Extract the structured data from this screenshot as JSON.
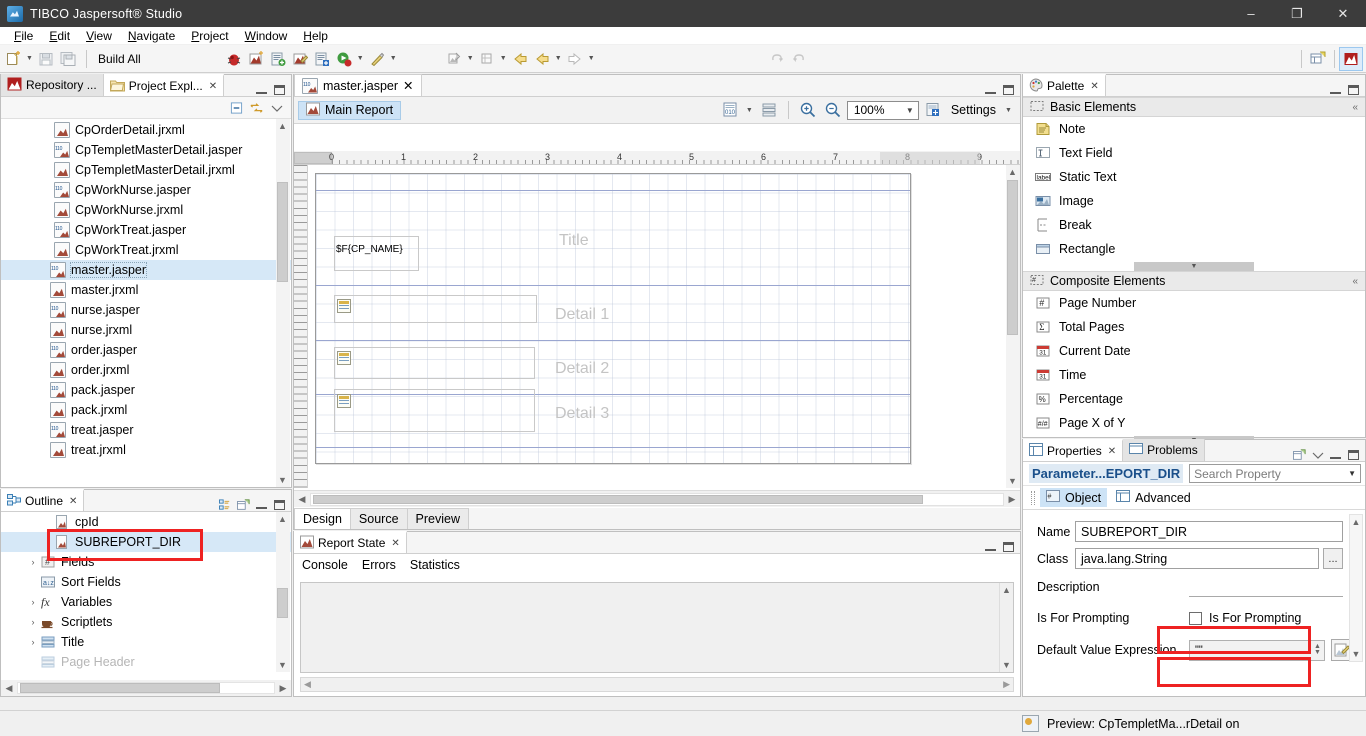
{
  "window": {
    "title": "TIBCO Jaspersoft® Studio",
    "app_icon": "jaspersoft-logo-icon",
    "minimize": "–",
    "maximize": "❐",
    "close": "✕"
  },
  "menubar": {
    "items": [
      "File",
      "Edit",
      "View",
      "Navigate",
      "Project",
      "Window",
      "Help"
    ]
  },
  "toolbar": {
    "build_all_label": "Build All",
    "icons": [
      "new-file-icon",
      "save-icon",
      "save-all-icon",
      "debug-icon",
      "run-report-icon",
      "compile-report-icon",
      "edit-report-icon",
      "preview-report-icon",
      "run-external-icon",
      "run-last-icon",
      "external-tools-icon",
      "next-annotation-icon",
      "previous-annotation-icon",
      "back-icon",
      "forward-icon",
      "undo-arrow-icon",
      "redo-arrow-icon"
    ],
    "perspective_icons": [
      "open-perspective-icon",
      "report-perspective-icon"
    ]
  },
  "project_explorer": {
    "tabs": [
      {
        "label": "Repository ...",
        "icon": "repository-icon",
        "active": false,
        "closeable": false
      },
      {
        "label": "Project Expl...",
        "icon": "project-explorer-icon",
        "active": true,
        "closeable": true
      }
    ],
    "toolbar_icons": [
      "collapse-all-icon",
      "link-with-editor-icon",
      "view-menu-icon"
    ],
    "files": [
      {
        "name": "CpOrderDetail.jrxml",
        "icon": "jrxml-file-icon",
        "selected": false
      },
      {
        "name": "CpTempletMasterDetail.jasper",
        "icon": "jasper-file-icon",
        "selected": false
      },
      {
        "name": "CpTempletMasterDetail.jrxml",
        "icon": "jrxml-file-icon",
        "selected": false
      },
      {
        "name": "CpWorkNurse.jasper",
        "icon": "jasper-file-icon",
        "selected": false
      },
      {
        "name": "CpWorkNurse.jrxml",
        "icon": "jrxml-file-icon",
        "selected": false
      },
      {
        "name": "CpWorkTreat.jasper",
        "icon": "jasper-file-icon",
        "selected": false
      },
      {
        "name": "CpWorkTreat.jrxml",
        "icon": "jrxml-file-icon",
        "selected": false
      },
      {
        "name": "master.jasper",
        "icon": "jasper-file-icon",
        "selected": true
      },
      {
        "name": "master.jrxml",
        "icon": "jrxml-file-icon",
        "selected": false
      },
      {
        "name": "nurse.jasper",
        "icon": "jasper-file-icon",
        "selected": false
      },
      {
        "name": "nurse.jrxml",
        "icon": "jrxml-file-icon",
        "selected": false
      },
      {
        "name": "order.jasper",
        "icon": "jasper-file-icon",
        "selected": false
      },
      {
        "name": "order.jrxml",
        "icon": "jrxml-file-icon",
        "selected": false
      },
      {
        "name": "pack.jasper",
        "icon": "jasper-file-icon",
        "selected": false
      },
      {
        "name": "pack.jrxml",
        "icon": "jrxml-file-icon",
        "selected": false
      },
      {
        "name": "treat.jasper",
        "icon": "jasper-file-icon",
        "selected": false
      },
      {
        "name": "treat.jrxml",
        "icon": "jrxml-file-icon",
        "selected": false
      }
    ]
  },
  "outline": {
    "tab_label": "Outline",
    "tab_icon": "outline-icon",
    "toolbar_icons": [
      "sort-outline-icon",
      "show-properties-icon"
    ],
    "rows": [
      {
        "label": "cpId",
        "icon": "parameter-icon",
        "expander": "",
        "selected": false,
        "dim": false
      },
      {
        "label": "SUBREPORT_DIR",
        "icon": "parameter-icon",
        "expander": "",
        "selected": true,
        "dim": false
      },
      {
        "label": "Fields",
        "icon": "fields-icon",
        "expander": "›",
        "selected": false,
        "dim": false
      },
      {
        "label": "Sort Fields",
        "icon": "sort-fields-icon",
        "expander": "",
        "selected": false,
        "dim": false
      },
      {
        "label": "Variables",
        "icon": "variables-fx-icon",
        "expander": "›",
        "selected": false,
        "dim": false
      },
      {
        "label": "Scriptlets",
        "icon": "scriptlets-coffee-icon",
        "expander": "›",
        "selected": false,
        "dim": false
      },
      {
        "label": "Title",
        "icon": "band-icon",
        "expander": "›",
        "selected": false,
        "dim": false
      },
      {
        "label": "Page Header",
        "icon": "band-icon",
        "expander": "",
        "selected": false,
        "dim": true
      }
    ]
  },
  "editor": {
    "tab": {
      "label": "master.jasper",
      "icon": "jasper-file-icon",
      "close": "✕"
    },
    "main_report_button": "Main Report",
    "main_report_icon": "report-icon",
    "zoom_value": "100%",
    "settings_label": "Settings",
    "toolbar_icons": [
      "data-adapter-icon",
      "bands-icon",
      "zoom-in-icon",
      "zoom-out-icon",
      "settings-icon"
    ],
    "ruler_marks": [
      "0",
      "1",
      "2",
      "3",
      "4",
      "5",
      "6",
      "7",
      "8",
      "9"
    ],
    "bottom_tabs": [
      {
        "label": "Design",
        "active": true
      },
      {
        "label": "Source",
        "active": false
      },
      {
        "label": "Preview",
        "active": false
      }
    ],
    "canvas": {
      "title_field_text": "$F{CP_NAME}",
      "bands": [
        {
          "label": "Title"
        },
        {
          "label": "Detail 1"
        },
        {
          "label": "Detail 2"
        },
        {
          "label": "Detail 3"
        }
      ],
      "subreport_icon": "subreport-element-icon"
    }
  },
  "report_state": {
    "tab_label": "Report State",
    "tab_icon": "report-state-icon",
    "close": "✕",
    "subtabs": [
      "Console",
      "Errors",
      "Statistics"
    ],
    "console_text": ""
  },
  "palette": {
    "tab_label": "Palette",
    "tab_icon": "palette-icon",
    "close": "✕",
    "sections": [
      {
        "title": "Basic Elements",
        "icon": "basic-elements-icon",
        "items": [
          {
            "label": "Note",
            "icon": "note-icon"
          },
          {
            "label": "Text Field",
            "icon": "text-field-icon"
          },
          {
            "label": "Static Text",
            "icon": "static-text-icon"
          },
          {
            "label": "Image",
            "icon": "image-icon"
          },
          {
            "label": "Break",
            "icon": "break-icon"
          },
          {
            "label": "Rectangle",
            "icon": "rectangle-icon"
          }
        ]
      },
      {
        "title": "Composite Elements",
        "icon": "composite-elements-icon",
        "items": [
          {
            "label": "Page Number",
            "icon": "page-number-icon"
          },
          {
            "label": "Total Pages",
            "icon": "total-pages-icon"
          },
          {
            "label": "Current Date",
            "icon": "current-date-icon"
          },
          {
            "label": "Time",
            "icon": "time-icon"
          },
          {
            "label": "Percentage",
            "icon": "percentage-icon"
          },
          {
            "label": "Page X of Y",
            "icon": "page-x-of-y-icon"
          }
        ]
      }
    ]
  },
  "properties": {
    "tabs": [
      {
        "label": "Properties",
        "icon": "properties-icon",
        "active": true,
        "closeable": true
      },
      {
        "label": "Problems",
        "icon": "problems-icon",
        "active": false,
        "closeable": false
      }
    ],
    "toolbar_icons": [
      "pin-properties-icon",
      "view-menu-icon",
      "minimize-icon",
      "maximize-icon"
    ],
    "object_title": "Parameter...EPORT_DIR",
    "search_placeholder": "Search Property",
    "inner_tabs": [
      {
        "label": "Object",
        "icon": "object-tab-icon",
        "active": true
      },
      {
        "label": "Advanced",
        "icon": "advanced-tab-icon",
        "active": false
      }
    ],
    "fields": {
      "name_label": "Name",
      "name_value": "SUBREPORT_DIR",
      "class_label": "Class",
      "class_value": "java.lang.String",
      "class_browse": "...",
      "description_label": "Description",
      "description_value": "",
      "is_for_prompting_label": "Is For Prompting",
      "is_for_prompting_checkbox_label": "Is For Prompting",
      "is_for_prompting_checked": false,
      "default_value_label": "Default Value Expression",
      "default_value_value": "\"\"",
      "expression_edit_icon": "expression-editor-icon"
    }
  },
  "statusbar": {
    "preview_text": "Preview: CpTempletMa...rDetail on",
    "preview_icon": "preview-status-icon"
  },
  "annotations": {
    "highlight_color": "#ee2222",
    "boxes": [
      "outline-subreport-dir",
      "is-for-prompting",
      "default-value-expression"
    ]
  }
}
